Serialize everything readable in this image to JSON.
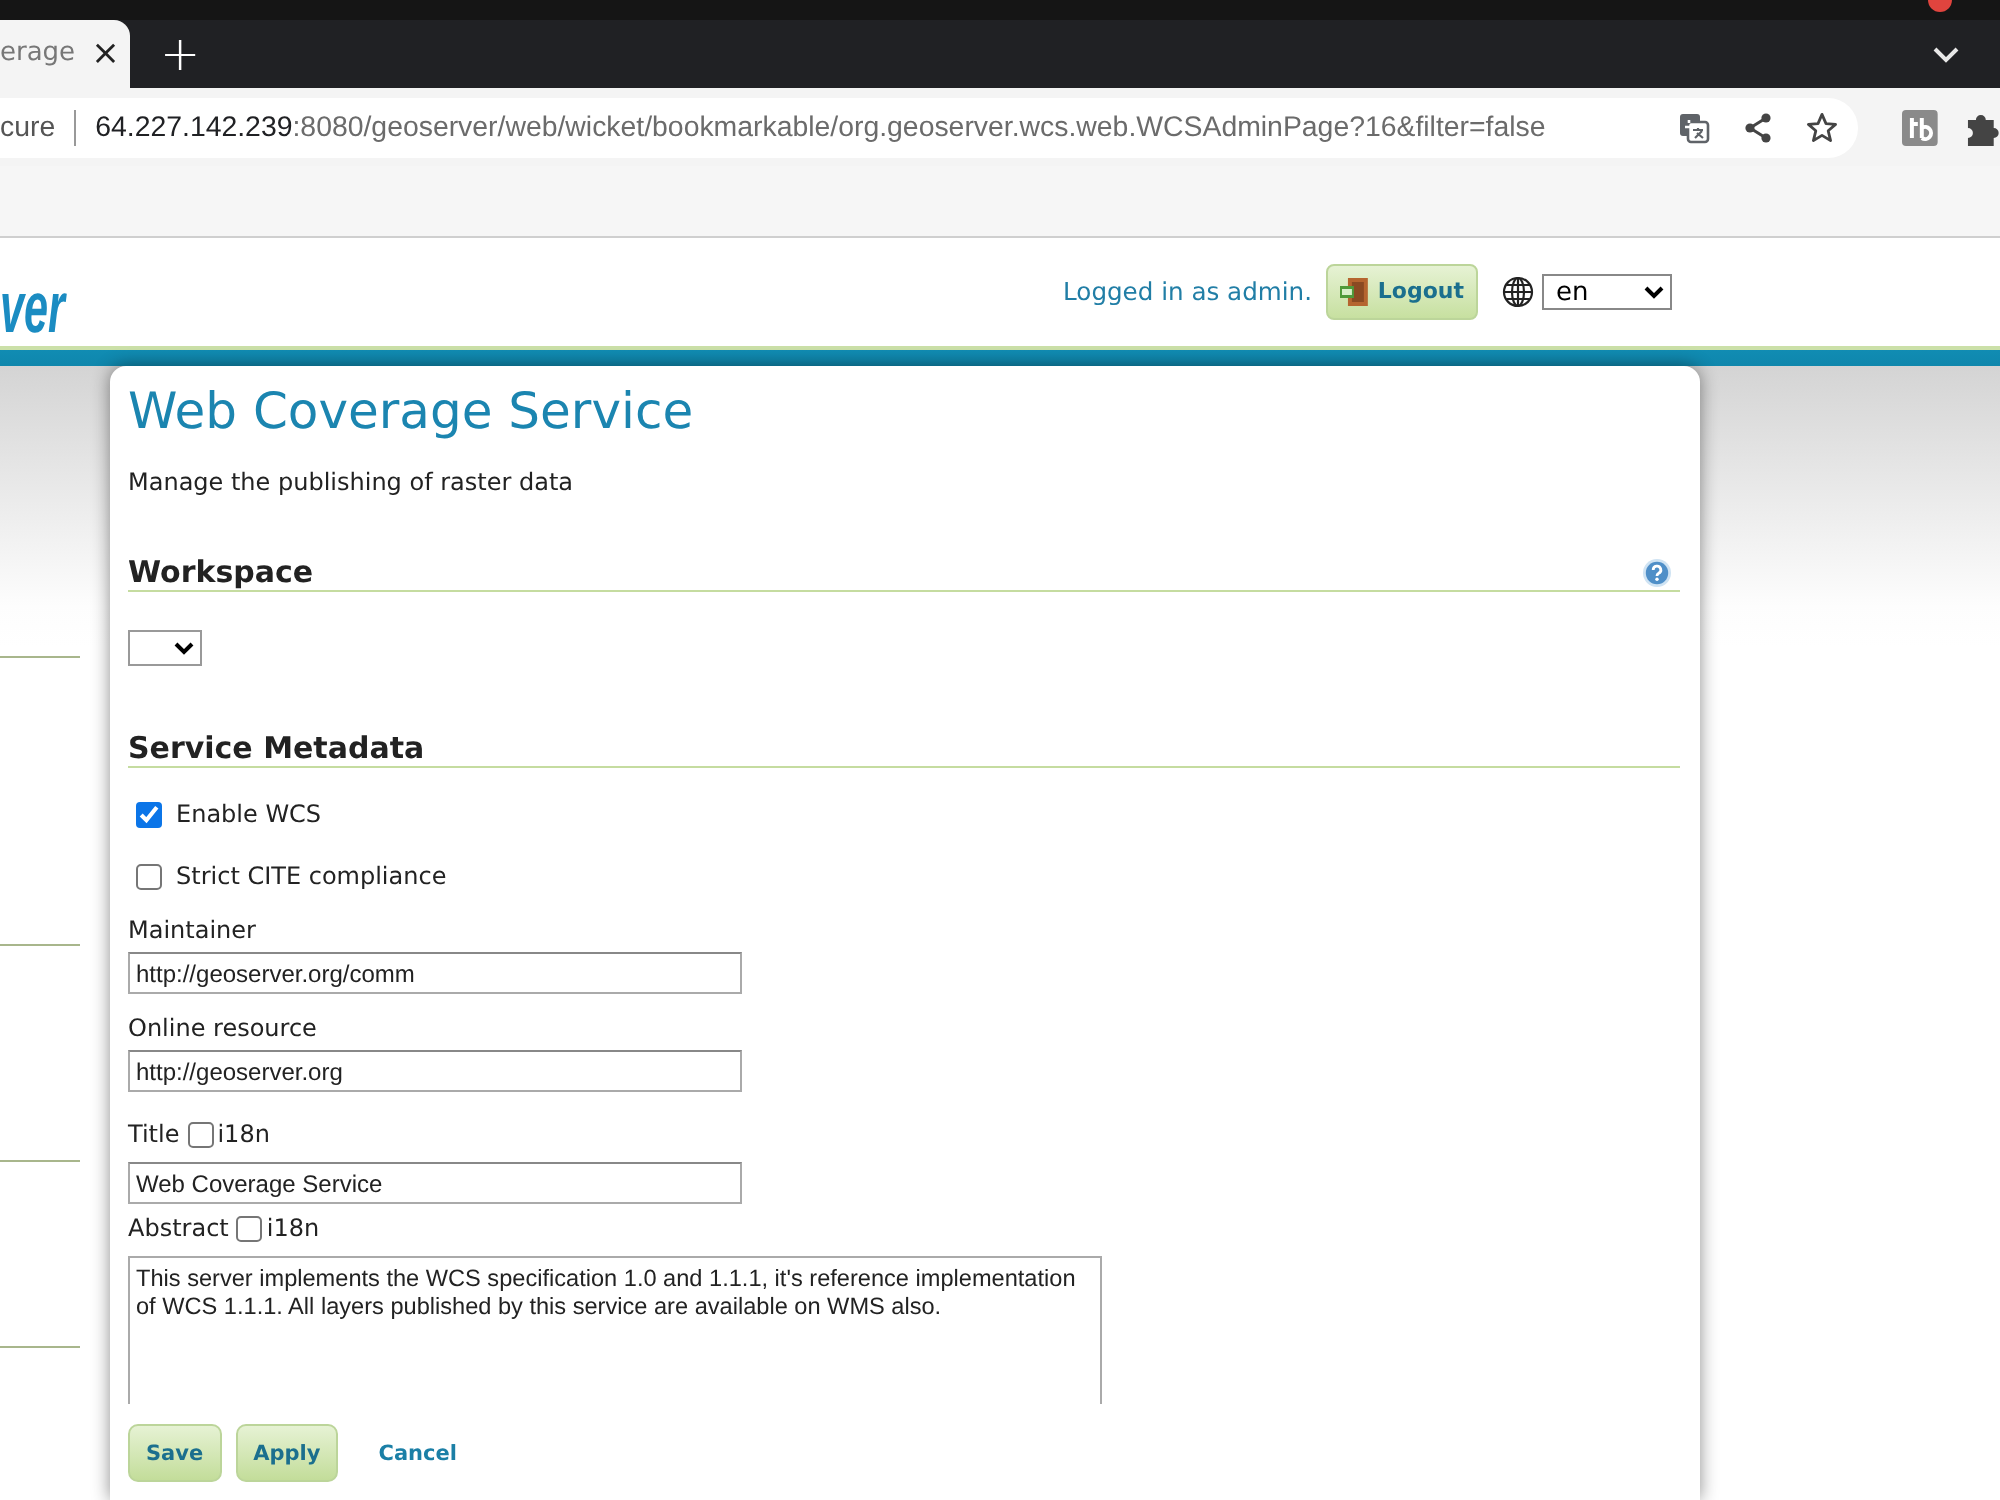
{
  "browser": {
    "tab": {
      "title": "erage",
      "close": "×"
    },
    "new_tab": "+",
    "address_bar": {
      "security": "cure",
      "url": {
        "host": "64.227.142.239",
        "path": ":8080/geoserver/web/wicket/bookmarkable/org.geoserver.wcs.web.WCSAdminPage?16&filter=false"
      }
    }
  },
  "header": {
    "logo": "ver",
    "login_status": "Logged in as admin.",
    "logout_button": "Logout",
    "language": "en"
  },
  "page": {
    "title": "Web Coverage Service",
    "description": "Manage the publishing of raster data"
  },
  "workspace": {
    "heading": "Workspace"
  },
  "service_metadata": {
    "heading": "Service Metadata",
    "checkboxes": [
      {
        "label": "Enable WCS",
        "checked": true
      },
      {
        "label": "Strict CITE compliance",
        "checked": false
      }
    ],
    "fields": [
      {
        "kind": "input",
        "label": "Maintainer",
        "value": "http://geoserver.org/comm"
      },
      {
        "kind": "input",
        "label": "Online resource",
        "value": "http://geoserver.org"
      },
      {
        "kind": "input",
        "label": "Title",
        "i18n": {
          "label": "i18n",
          "checked": false
        },
        "value": "Web Coverage Service"
      },
      {
        "kind": "textarea",
        "label": "Abstract",
        "i18n": {
          "label": "i18n",
          "checked": false
        },
        "value": "This server implements the WCS specification 1.0 and 1.1.1, it's reference implementation of WCS 1.1.1. All layers published by this service are available on WMS also."
      }
    ]
  },
  "actions": [
    {
      "kind": "button",
      "label": "Save"
    },
    {
      "kind": "button",
      "label": "Apply"
    },
    {
      "kind": "link",
      "label": "Cancel"
    }
  ]
}
